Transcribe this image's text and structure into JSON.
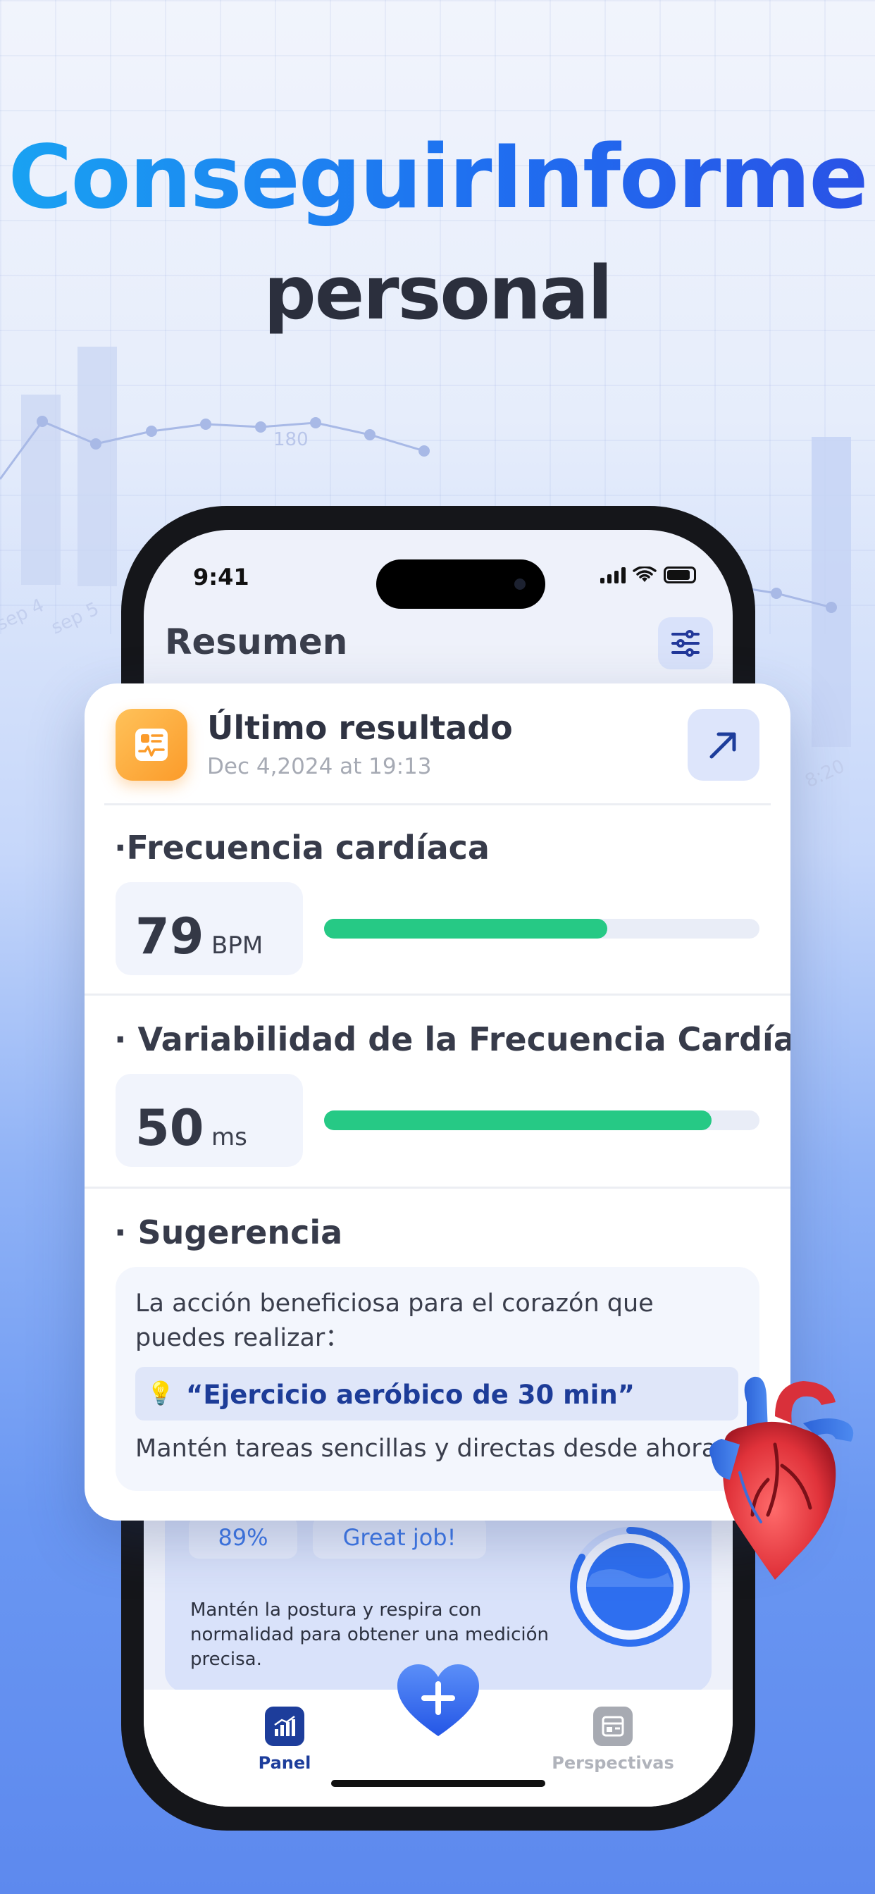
{
  "headline": {
    "line1": "ConseguirInforme",
    "line2": "personal"
  },
  "background_chart": {
    "point_label": "180",
    "date_labels": [
      "sep 4",
      "sep 5",
      "8:20"
    ]
  },
  "status_bar": {
    "time": "9:41"
  },
  "screen": {
    "title": "Resumen"
  },
  "card": {
    "title": "Último resultado",
    "date": "Dec 4,2024 at 19:13",
    "heart_rate": {
      "title": "·Frecuencia cardíaca",
      "value": "79",
      "unit": "BPM",
      "progress": 0.65
    },
    "hrv": {
      "title": "· Variabilidad de la Frecuencia Cardíaca",
      "value": "50",
      "unit": "ms",
      "progress": 0.89
    },
    "suggestion": {
      "title": "· Sugerencia",
      "text": "La acción beneficiosa para el corazón que puedes realizar：",
      "tip": "“Ejercicio aeróbico de 30 min”",
      "footer": "Mantén tareas sencillas y directas desde ahora"
    }
  },
  "background_panel": {
    "percent": "89%",
    "badge": "Great job!",
    "text": "Mantén la postura y respira con normalidad para obtener una medición precisa."
  },
  "tabbar": {
    "panel": "Panel",
    "insights": "Perspectivas"
  },
  "colors": {
    "accent": "#2f5ee8",
    "progress": "#26c985",
    "icon_orange": "#fb9b2a"
  }
}
